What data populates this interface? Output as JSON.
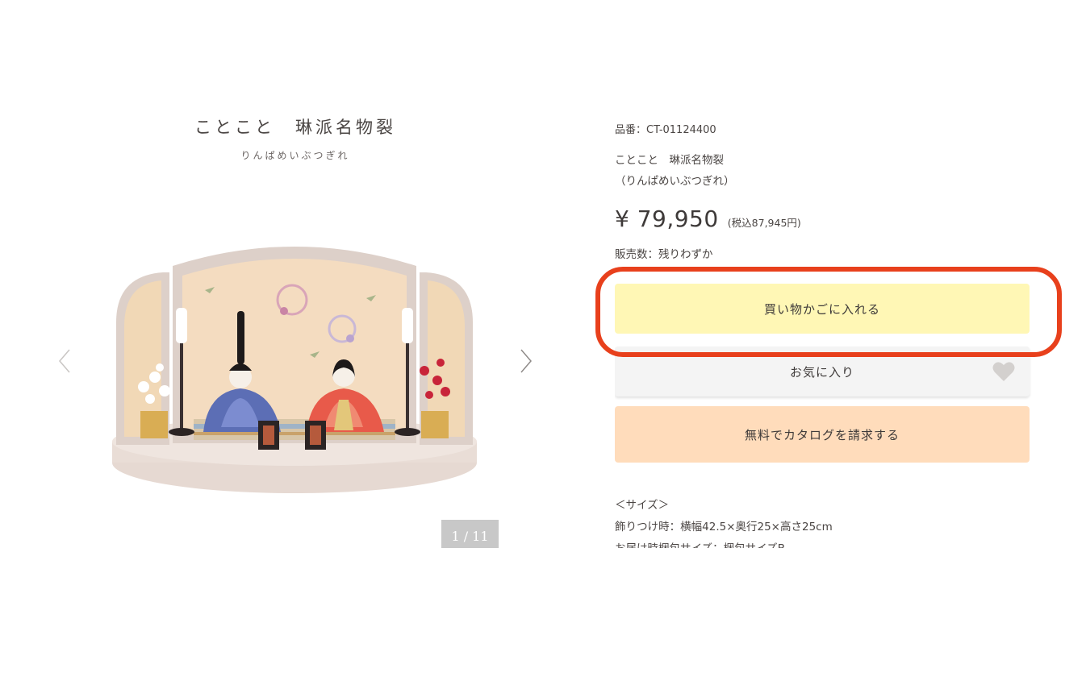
{
  "product": {
    "title": "ことこと　琳派名物裂",
    "subtitle": "りんぱめいぶつぎれ",
    "sku": "品番：CT-01124400",
    "name_line1": "ことこと　琳派名物裂",
    "name_line2": "（りんぱめいぶつぎれ）",
    "price": "¥ 79,950",
    "tax_price": "(税込87,945円)",
    "stock": "販売数：残りわずか"
  },
  "gallery": {
    "counter": "1 / 11",
    "prev_icon": "chevron-left-icon",
    "next_icon": "chevron-right-icon"
  },
  "buttons": {
    "cart_label": "買い物かごに入れる",
    "favorite_label": "お気に入り",
    "catalog_label": "無料でカタログを請求する"
  },
  "size": {
    "heading": "＜サイズ＞",
    "dimensions": "飾りつけ時：横幅42.5×奥行25×高さ25cm",
    "shipping": "お届け時梱包サイズ：梱包サイズB"
  },
  "colors": {
    "cart_bg": "#fff7b5",
    "favorite_bg": "#f4f4f4",
    "catalog_bg": "#ffdcbb",
    "highlight": "#e8401c"
  }
}
